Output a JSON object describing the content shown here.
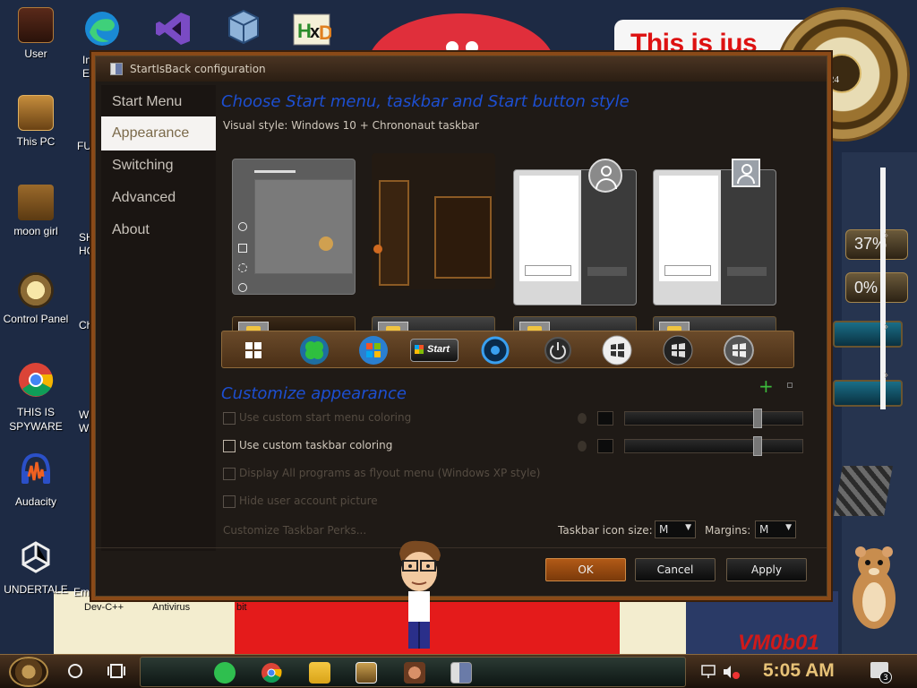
{
  "desktop": {
    "top_icons": [
      {
        "name": "edge",
        "label": "In\nEx"
      },
      {
        "name": "visual-studio",
        "label": ""
      },
      {
        "name": "virtualbox",
        "label": ""
      },
      {
        "name": "hxd",
        "label": ""
      }
    ],
    "left_icons": [
      {
        "label": "User"
      },
      {
        "label": "This PC"
      },
      {
        "label": "moon girl"
      },
      {
        "label": "Control Panel"
      },
      {
        "label": "THIS IS SPYWARE"
      },
      {
        "label": "Audacity"
      },
      {
        "label": "UNDERTALE"
      }
    ],
    "partial_labels": [
      "FUR",
      "SH HO",
      "Ch",
      "W Wr",
      "Emb",
      "Dev-C++",
      "Antivirus",
      "bit"
    ],
    "banner_text": "This is jus",
    "widget_percent_1": "37%",
    "widget_percent_2": "0%",
    "clock_number": "24",
    "wallpaper_text": "VM0b01"
  },
  "dialog": {
    "title": "StartIsBack configuration",
    "nav": [
      {
        "label": "Start Menu"
      },
      {
        "label": "Appearance"
      },
      {
        "label": "Switching"
      },
      {
        "label": "Advanced"
      },
      {
        "label": "About"
      }
    ],
    "active_nav": "Appearance",
    "heading_style": "Choose Start menu, taskbar and Start button style",
    "visual_style": "Visual style:  Windows 10 + Chrononaut taskbar",
    "start_button_labels": {
      "start_text": "Start"
    },
    "heading_customize": "Customize appearance",
    "options": [
      {
        "label": "Use custom start menu coloring",
        "enabled": false
      },
      {
        "label": "Use custom taskbar coloring",
        "enabled": true
      },
      {
        "label": "Display All programs as flyout menu (Windows XP style)",
        "enabled": false
      },
      {
        "label": "Hide user account picture",
        "enabled": false
      }
    ],
    "perks_link": "Customize Taskbar Perks...",
    "taskbar_icon_size_label": "Taskbar icon size:",
    "taskbar_icon_size_value": "M",
    "margins_label": "Margins:",
    "margins_value": "M",
    "buttons": {
      "ok": "OK",
      "cancel": "Cancel",
      "apply": "Apply"
    }
  },
  "taskbar": {
    "time": "5:05 AM",
    "notification_count": "3"
  },
  "colors": {
    "accent_heading": "#1d4fd1",
    "primary_button": "#b25a17",
    "dialog_bg": "#1f1a16",
    "time_color": "#e7c277"
  }
}
